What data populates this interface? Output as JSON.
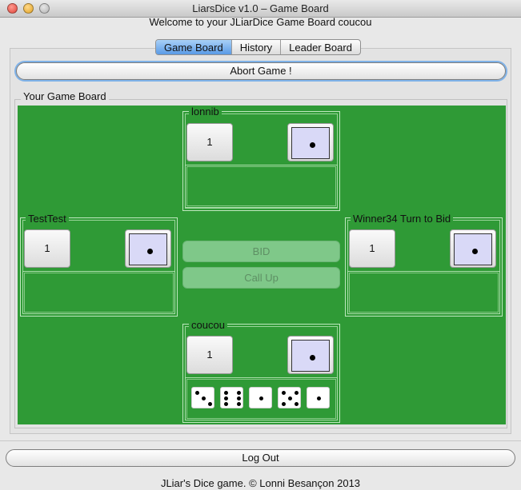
{
  "window": {
    "title": "LiarsDice v1.0 – Game Board"
  },
  "header": {
    "welcome": "Welcome to your JLiarDice Game Board coucou"
  },
  "tabs": [
    {
      "label": "Game Board",
      "active": true
    },
    {
      "label": "History",
      "active": false
    },
    {
      "label": "Leader Board",
      "active": false
    }
  ],
  "actions": {
    "abort_label": "Abort Game !",
    "bid_label": "BID",
    "callup_label": "Call Up",
    "logout_label": "Log Out"
  },
  "board": {
    "title": "Your Game Board",
    "background_color": "#2f9a36",
    "players": {
      "top": {
        "name": "lonnib",
        "bid_count": "1",
        "bid_face": 1
      },
      "left": {
        "name": "TestTest",
        "bid_count": "1",
        "bid_face": 1
      },
      "right": {
        "name": "Winner34 Turn to Bid",
        "bid_count": "1",
        "bid_face": 1
      },
      "bottom": {
        "name": "coucou",
        "bid_count": "1",
        "bid_face": 1,
        "dice": [
          3,
          6,
          1,
          5,
          1
        ]
      }
    }
  },
  "footer": {
    "text": "JLiar's Dice game. © Lonni Besançon 2013"
  }
}
